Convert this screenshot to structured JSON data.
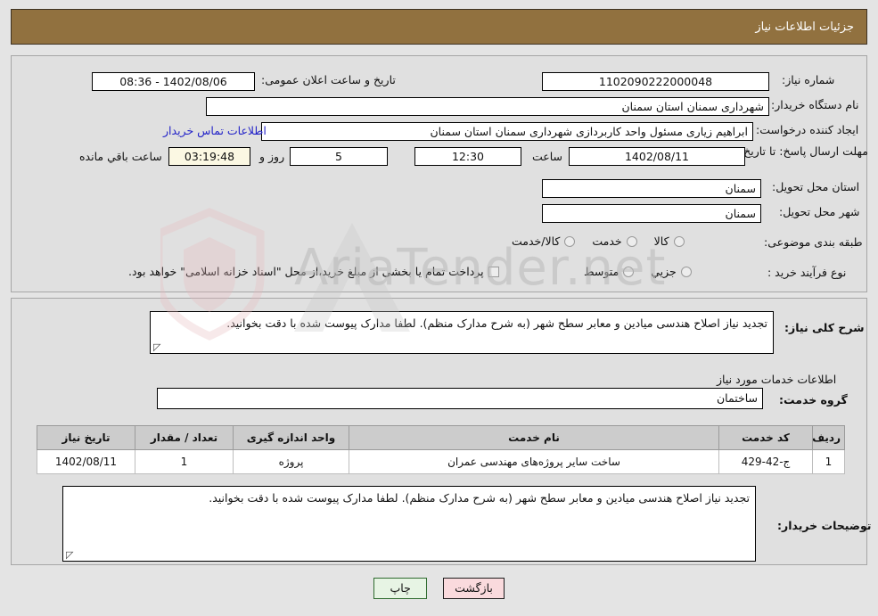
{
  "header": {
    "title": "جزئیات اطلاعات نیاز"
  },
  "watermark": {
    "text": "AriaTender.net"
  },
  "top_form": {
    "need_number_label": "شماره نیاز:",
    "need_number_value": "1102090222000048",
    "public_announce_label": "تاریخ و ساعت اعلان عمومی:",
    "public_announce_value": "1402/08/06 - 08:36",
    "buyer_org_label": "نام دستگاه خریدار:",
    "buyer_org_value": "شهرداری سمنان استان سمنان",
    "creator_label": "ایجاد کننده درخواست:",
    "creator_value": "ابراهیم زیاری مسئول واحد کاربردازی شهرداری سمنان استان سمنان",
    "buyer_contact_link": "اطلاعات تماس خریدار",
    "deadline_label": "مهلت ارسال پاسخ: تا تاریخ:",
    "deadline_date": "1402/08/11",
    "deadline_hour_label": "ساعت",
    "deadline_hour_value": "12:30",
    "remaining_days": "5",
    "remaining_days_label": "روز و",
    "remaining_time": "03:19:48",
    "remaining_time_label": "ساعت باقي مانده",
    "province_label": "استان محل تحویل:",
    "province_value": "سمنان",
    "city_label": "شهر محل تحویل:",
    "city_value": "سمنان",
    "category_label": "طبقه بندی موضوعی:",
    "category_options": [
      {
        "label": "کالا",
        "selected": false
      },
      {
        "label": "خدمت",
        "selected": false
      },
      {
        "label": "کالا/خدمت",
        "selected": false
      }
    ],
    "process_label": "نوع فرآیند خرید :",
    "process_options": [
      {
        "label": "جزیي",
        "selected": false
      },
      {
        "label": "متوسط",
        "selected": false
      }
    ],
    "treasury_checkbox_text": "پرداخت تمام یا بخشی از مبلغ خرید،از محل \"اسناد خزانه اسلامی\" خواهد بود."
  },
  "middle": {
    "general_desc_label": "شرح کلی نیاز:",
    "general_desc_value": "تجدید نیاز اصلاح هندسی میادین و معابر سطح شهر (به شرح مدارک منظم). لطفا مدارک پیوست شده با دقت بخوانید.",
    "services_section_title": "اطلاعات خدمات مورد نیاز",
    "service_group_label": "گروه خدمت:",
    "service_group_value": "ساختمان",
    "buyer_notes_label": "توضیحات خریدار:",
    "buyer_notes_value": "تجدید نیاز اصلاح هندسی میادین و معابر سطح شهر (به شرح مدارک منظم). لطفا مدارک پیوست شده با دقت بخوانید."
  },
  "table": {
    "columns": [
      "ردیف",
      "کد خدمت",
      "نام خدمت",
      "واحد اندازه گیری",
      "تعداد / مقدار",
      "تاریخ نیاز"
    ],
    "rows": [
      {
        "row_no": "1",
        "service_code": "ج-42-429",
        "service_name": "ساخت سایر پروژه‌های مهندسی عمران",
        "unit": "پروژه",
        "quantity": "1",
        "need_date": "1402/08/11"
      }
    ]
  },
  "buttons": {
    "print": "چاپ",
    "back": "بازگشت"
  },
  "colors": {
    "header_bg": "#91713f",
    "panel_bg": "#e0e0e0",
    "page_bg": "#e4e4e4",
    "link": "#2323c8",
    "table_head_bg": "#cccccc",
    "countdown_bg": "#fbf8e3",
    "print_btn_bg": "#e7f4e4",
    "back_btn_bg": "#fadadd"
  }
}
